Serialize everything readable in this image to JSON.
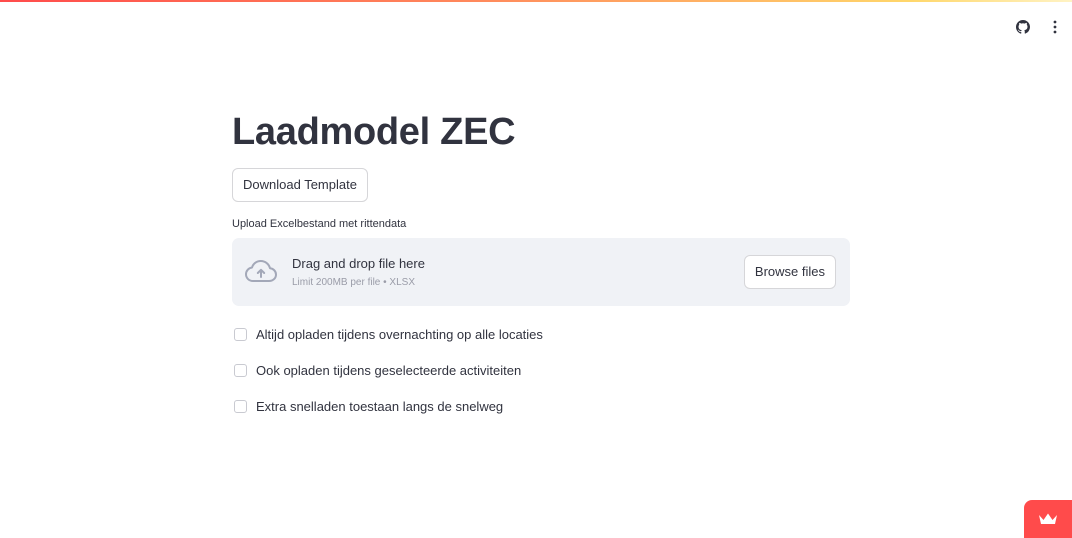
{
  "header": {
    "github_icon": "github-icon",
    "menu_icon": "vertical-dots-icon"
  },
  "main": {
    "title": "Laadmodel ZEC",
    "download_button": "Download Template",
    "uploader": {
      "label": "Upload Excelbestand met rittendata",
      "icon": "cloud-upload-icon",
      "drop_text": "Drag and drop file here",
      "limit_text": "Limit 200MB per file • XLSX",
      "browse_button": "Browse files"
    },
    "checkboxes": [
      {
        "label": "Altijd opladen tijdens overnachting op alle locaties",
        "checked": false
      },
      {
        "label": "Ook opladen tijdens geselecteerde activiteiten",
        "checked": false
      },
      {
        "label": "Extra snelladen toestaan langs de snelweg",
        "checked": false
      }
    ]
  },
  "badge": {
    "icon": "crown-icon"
  },
  "colors": {
    "accent": "#ff4b4b",
    "text": "#31333f",
    "dropzone_bg": "#f0f2f6"
  }
}
